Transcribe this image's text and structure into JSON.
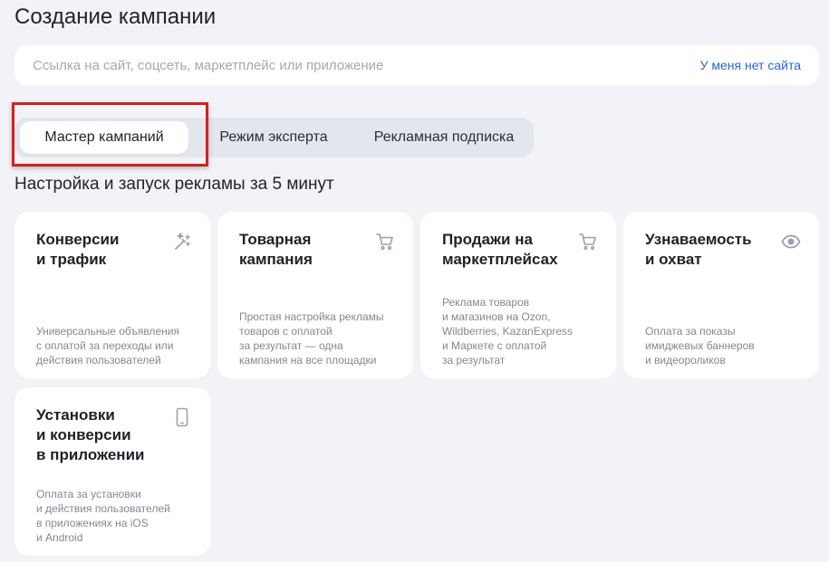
{
  "page": {
    "title": "Создание кампании"
  },
  "url_bar": {
    "placeholder": "Ссылка на сайт, соцсеть, маркетплейс или приложение",
    "value": "",
    "no_site_link": "У меня нет сайта"
  },
  "mode_tabs": [
    {
      "label": "Мастер кампаний",
      "active": true
    },
    {
      "label": "Режим эксперта",
      "active": false
    },
    {
      "label": "Рекламная подписка",
      "active": false
    }
  ],
  "section": {
    "title": "Настройка и запуск рекламы за 5 минут"
  },
  "cards": [
    {
      "title": "Конверсии\nи трафик",
      "description": "Универсальные объявления\nс оплатой за переходы или\nдействия пользователей",
      "icon": "magic-wand-icon"
    },
    {
      "title": "Товарная\nкампания",
      "description": "Простая настройка рекламы\nтоваров с оплатой\nза результат — одна\nкампания на все площадки",
      "icon": "cart-icon"
    },
    {
      "title": "Продажи на\nмаркетплейсах",
      "description": "Реклама товаров\nи магазинов на Ozon,\nWildberries, KazanExpress\nи Маркете с оплатой\nза результат",
      "icon": "cart-icon"
    },
    {
      "title": "Узнаваемость\nи охват",
      "description": "Оплата за показы\nимиджевых баннеров\nи видеороликов",
      "icon": "eye-icon"
    },
    {
      "title": "Установки\nи конверсии\nв приложении",
      "description": "Оплата за установки\nи действия пользователей\nв приложениях на iOS\nи Android",
      "icon": "smartphone-icon"
    }
  ],
  "colors": {
    "background": "#f2f3f6",
    "card": "#ffffff",
    "link": "#2e63d8",
    "highlight": "#d42020",
    "muted_text": "#828793"
  }
}
